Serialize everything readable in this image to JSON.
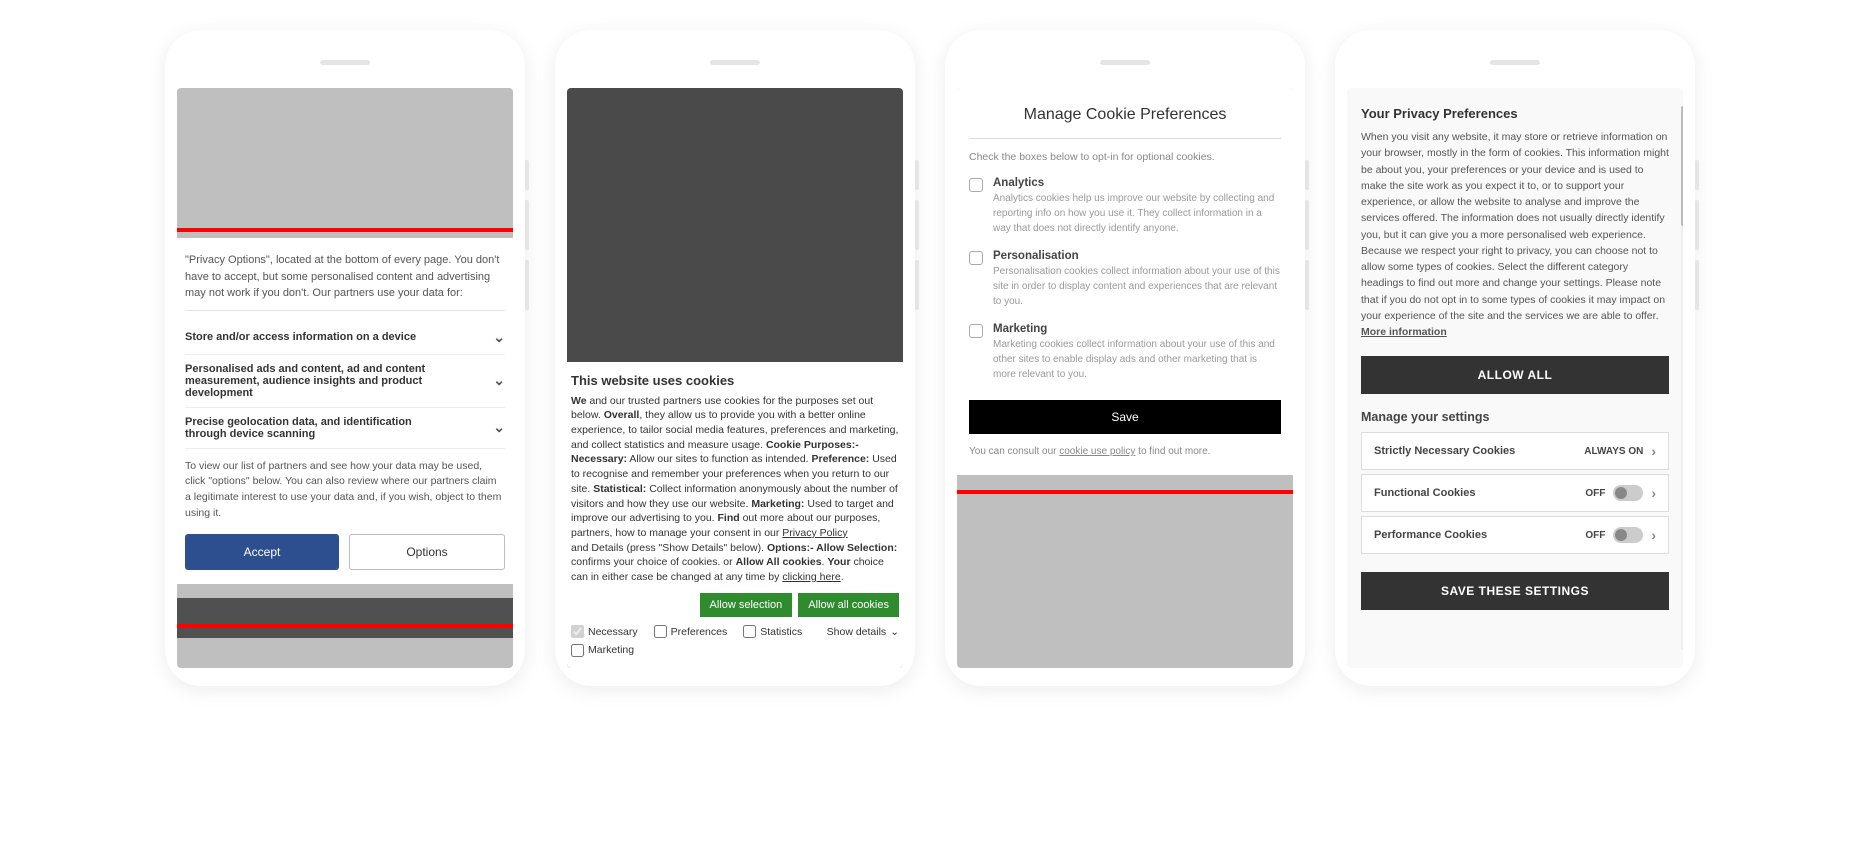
{
  "phone1": {
    "intro": "\"Privacy Options\", located at the bottom of every page. You don't have to accept, but some personalised content and advertising may not work if you don't. Our partners use your data for:",
    "rows": [
      "Store and/or access information on a device",
      "Personalised ads and content, ad and content measurement, audience insights and product development",
      "Precise geolocation data, and identification through device scanning"
    ],
    "note": "To view our list of partners and see how your data may be used, click \"options\" below. You can also review where our partners claim a legitimate interest to use your data and, if you wish, object to them using it.",
    "accept": "Accept",
    "options": "Options"
  },
  "phone2": {
    "title": "This website uses cookies",
    "we": "We",
    "t1": " and our trusted partners use cookies for the purposes set out below. ",
    "overall": "Overall",
    "t2": ", they allow us to provide you with a better online experience, to tailor social media features, preferences and marketing, and collect statistics and measure usage. ",
    "cp": "Cookie Purposes:- Necessary:",
    "t3": " Allow our sites to function as intended. ",
    "pref": "Preference:",
    "t4": " Used to recognise and remember your preferences when you return to our site. ",
    "stat": "Statistical:",
    "t5": " Collect information anonymously about the number of visitors and how they use our website. ",
    "mkt": "Marketing:",
    "t6": " Used to target and improve our advertising to you. ",
    "find": "Find",
    "t7": " out more about our purposes, partners, how to manage your consent in our ",
    "pp": "Privacy Policy",
    "t8": " and Details (press \"Show Details\" below). ",
    "opt": "Options:- Allow Selection:",
    "t9": " confirms your choice of cookies. or ",
    "allowall": "Allow All cookies",
    "t10": ". ",
    "your": "Your",
    "t11": " choice can in either case be changed at any time by ",
    "click": "clicking here",
    "t12": ".",
    "btn_sel": "Allow selection",
    "btn_all": "Allow all cookies",
    "c_nec": "Necessary",
    "c_pref": "Preferences",
    "c_stat": "Statistics",
    "c_mkt": "Marketing",
    "details": "Show details"
  },
  "phone3": {
    "title": "Manage Cookie Preferences",
    "sub": "Check the boxes below to opt-in for optional cookies.",
    "items": [
      {
        "title": "Analytics",
        "desc": "Analytics cookies help us improve our website by collecting and reporting info on how you use it. They collect information in a way that does not directly identify anyone."
      },
      {
        "title": "Personalisation",
        "desc": "Personalisation cookies collect information about your use of this site in order to display content and experiences that are relevant to you."
      },
      {
        "title": "Marketing",
        "desc": "Marketing cookies collect information about your use of this and other sites to enable display ads and other marketing that is more relevant to you."
      }
    ],
    "save": "Save",
    "footer_a": "You can consult our ",
    "footer_link": "cookie use policy",
    "footer_b": " to find out more."
  },
  "phone4": {
    "title": "Your Privacy Preferences",
    "body_a": "When you visit any website, it may store or retrieve information on your browser, mostly in the form of cookies. This information might be about you, your preferences or your device and is used to make the site work as you expect it to, or to support your experience, or allow the website to analyse and improve the services offered. The information does not usually directly identify you, but it can give you a more personalised web experience. Because we respect your right to privacy, you can choose not to allow some types of cookies. Select the different category headings to find out more and change your settings. Please note that if you do not opt in to some types of cookies it may impact on your experience of the site and the services we are able to offer.  ",
    "more": "More information",
    "allow": "ALLOW ALL",
    "manage": "Manage your settings",
    "settings": [
      {
        "label": "Strictly Necessary Cookies",
        "state": "ALWAYS ON",
        "toggle": false
      },
      {
        "label": "Functional Cookies",
        "state": "OFF",
        "toggle": true
      },
      {
        "label": "Performance Cookies",
        "state": "OFF",
        "toggle": true
      }
    ],
    "save": "SAVE THESE SETTINGS"
  }
}
